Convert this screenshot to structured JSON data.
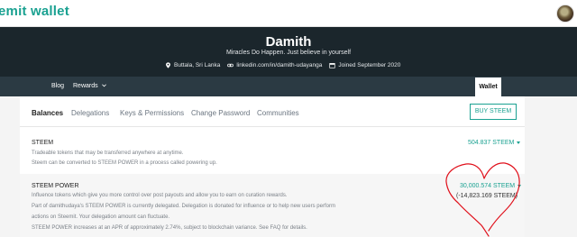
{
  "brand": "emit wallet",
  "profile": {
    "name": "Damith",
    "bio": "Miracles Do Happen. Just believe in yourself",
    "location": "Buttala, Sri Lanka",
    "website": "linkedin.com/in/damith-udayanga",
    "joined": "Joined September 2020"
  },
  "nav": {
    "blog": "Blog",
    "rewards": "Rewards",
    "wallet": "Wallet"
  },
  "tabs": [
    "Balances",
    "Delegations",
    "Keys & Permissions",
    "Change Password",
    "Communities"
  ],
  "buy_button": "BUY STEEM",
  "steem": {
    "title": "STEEM",
    "desc1": "Tradeable tokens that may be transferred anywhere at anytime.",
    "desc2": "Steem can be converted to STEEM POWER in a process called powering up.",
    "amount": "504.837 STEEM"
  },
  "steem_power": {
    "title": "STEEM POWER",
    "desc1": "Influence tokens which give you more control over post payouts and allow you to earn on curation rewards.",
    "desc2": "Part of damithudaya's STEEM POWER is currently delegated. Delegation is donated for influence or to help new users perform",
    "desc3": "actions on Steemit. Your delegation amount can fluctuate.",
    "desc4": "STEEM POWER increases at an APR of approximately 2.74%, subject to blockchain variance. See FAQ for details.",
    "amount": "30,000.574 STEEM",
    "delegated": "(-14,823.169 STEEM)"
  },
  "colors": {
    "accent": "#1aa191",
    "hero": "#1b262c",
    "nav": "#2b3a43",
    "annotation": "#e0101b"
  }
}
